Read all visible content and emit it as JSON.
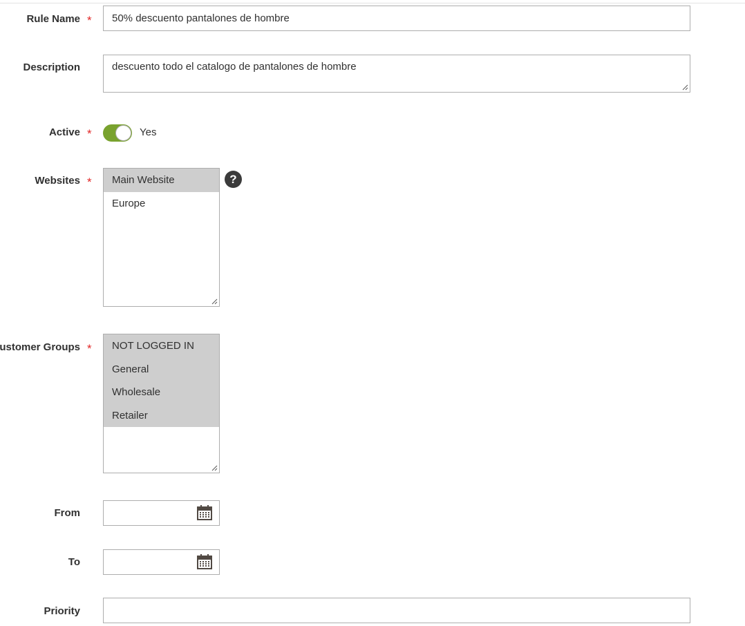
{
  "form": {
    "rule_name": {
      "label": "Rule Name",
      "required": "*",
      "value": "50% descuento pantalones de hombre"
    },
    "description": {
      "label": "Description",
      "value": "descuento todo el catalogo de pantalones de hombre"
    },
    "active": {
      "label": "Active",
      "required": "*",
      "state_text": "Yes",
      "checked": true
    },
    "websites": {
      "label": "Websites",
      "required": "*",
      "help_glyph": "?",
      "options": [
        {
          "label": "Main Website",
          "selected": true
        },
        {
          "label": "Europe",
          "selected": false
        }
      ]
    },
    "customer_groups": {
      "label": "Customer Groups",
      "required": "*",
      "options": [
        {
          "label": "NOT LOGGED IN",
          "selected": true
        },
        {
          "label": "General",
          "selected": true
        },
        {
          "label": "Wholesale",
          "selected": true
        },
        {
          "label": "Retailer",
          "selected": true
        }
      ]
    },
    "from": {
      "label": "From",
      "value": ""
    },
    "to": {
      "label": "To",
      "value": ""
    },
    "priority": {
      "label": "Priority",
      "value": ""
    }
  },
  "colors": {
    "toggle_on": "#79a22e",
    "required_star": "#e22626",
    "selected_option_bg": "#cecece",
    "border": "#adadad"
  },
  "icons": {
    "help": "question-circle-icon",
    "calendar": "calendar-icon",
    "resize": "resize-grip-icon"
  }
}
